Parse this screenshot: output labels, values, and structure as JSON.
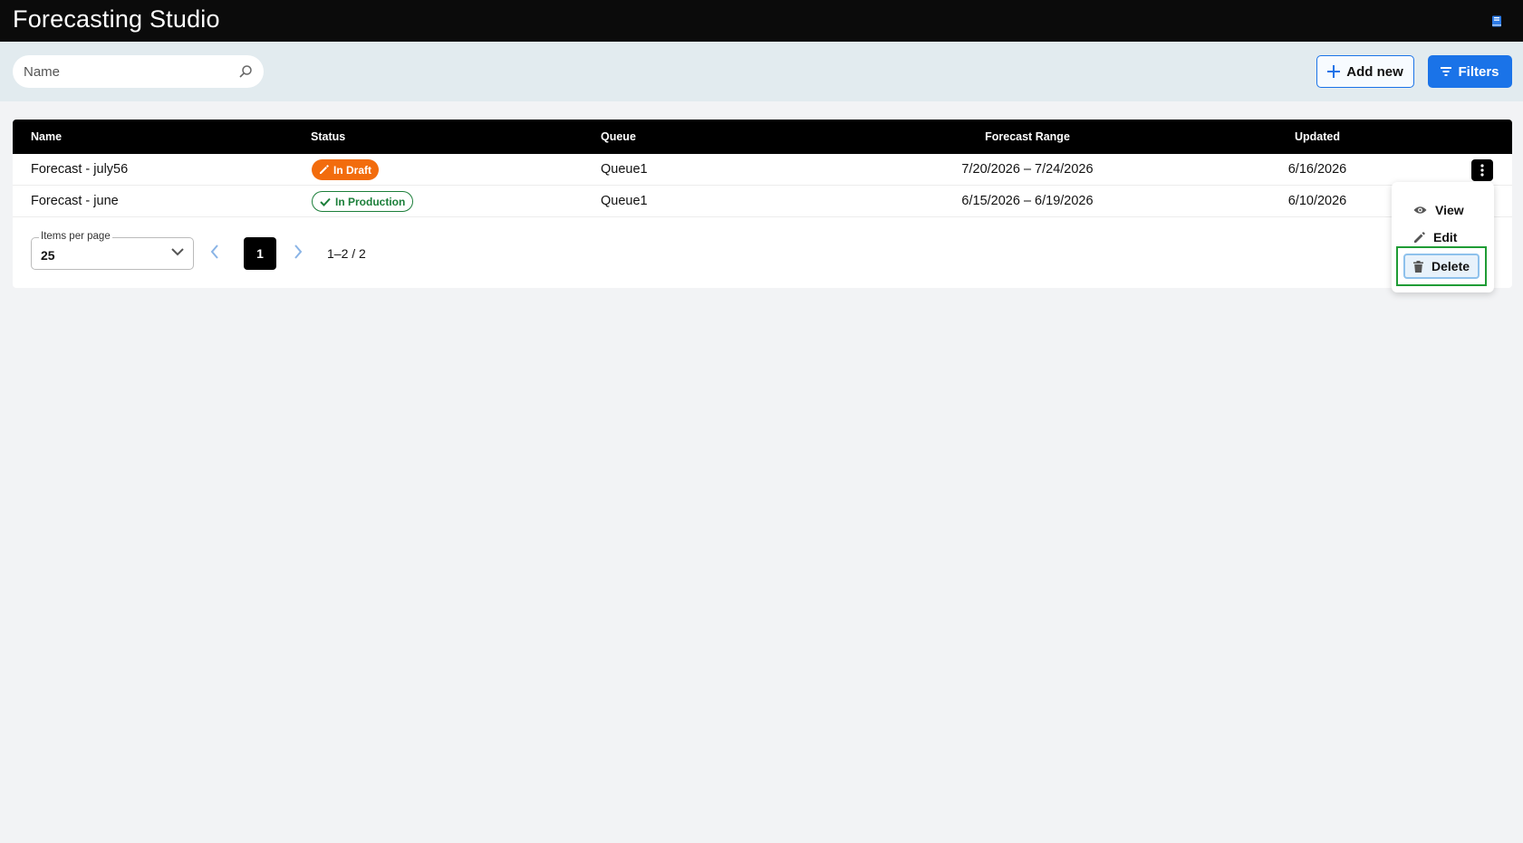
{
  "app": {
    "title": "Forecasting Studio"
  },
  "toolbar": {
    "search_placeholder": "Name",
    "add_label": "Add new",
    "filters_label": "Filters"
  },
  "table": {
    "columns": [
      "Name",
      "Status",
      "Queue",
      "Forecast Range",
      "Updated"
    ],
    "rows": [
      {
        "name": "Forecast - july56",
        "status": "In Draft",
        "queue": "Queue1",
        "range": "7/20/2026 – 7/24/2026",
        "updated": "6/16/2026"
      },
      {
        "name": "Forecast - june",
        "status": "In Production",
        "queue": "Queue1",
        "range": "6/15/2026 – 6/19/2026",
        "updated": "6/10/2026"
      }
    ]
  },
  "pagination": {
    "items_per_page_label": "Items per page",
    "items_per_page_value": "25",
    "current_page": "1",
    "range_text": "1–2 / 2"
  },
  "row_menu": {
    "view": "View",
    "edit": "Edit",
    "delete": "Delete"
  },
  "colors": {
    "accent": "#1a73e8",
    "draft": "#f26c0d",
    "production": "#1c7f3a",
    "highlight": "#1f9c35"
  }
}
